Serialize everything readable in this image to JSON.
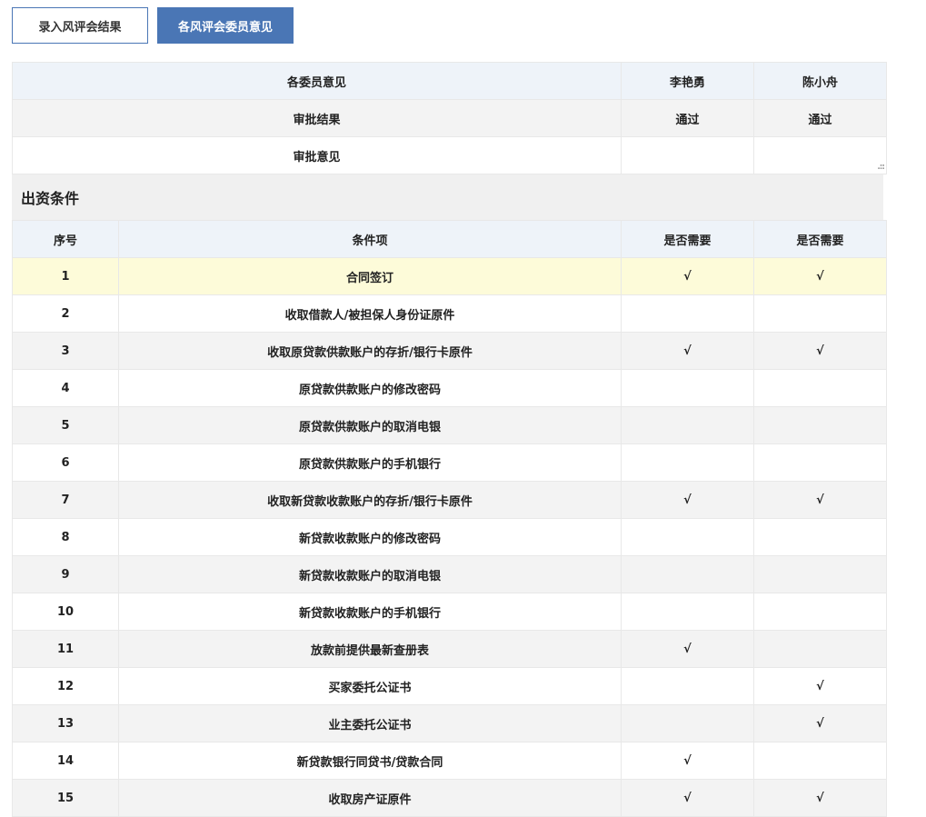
{
  "tabs": {
    "enter_result": "录入风评会结果",
    "member_opinions": "各风评会委员意见"
  },
  "opinions": {
    "header_label": "各委员意见",
    "members": [
      "李艳勇",
      "陈小舟"
    ],
    "result_label": "审批结果",
    "results": [
      "通过",
      "通过"
    ],
    "opinion_label": "审批意见",
    "opinions": [
      "",
      ""
    ]
  },
  "conditions": {
    "title": "出资条件",
    "headers": {
      "index": "序号",
      "item": "条件项",
      "need_1": "是否需要",
      "need_2": "是否需要"
    },
    "rows": [
      {
        "no": "1",
        "item": "合同签订",
        "a": "√",
        "b": "√"
      },
      {
        "no": "2",
        "item": "收取借款人/被担保人身份证原件",
        "a": "",
        "b": ""
      },
      {
        "no": "3",
        "item": "收取原贷款供款账户的存折/银行卡原件",
        "a": "√",
        "b": "√"
      },
      {
        "no": "4",
        "item": "原贷款供款账户的修改密码",
        "a": "",
        "b": ""
      },
      {
        "no": "5",
        "item": "原贷款供款账户的取消电银",
        "a": "",
        "b": ""
      },
      {
        "no": "6",
        "item": "原贷款供款账户的手机银行",
        "a": "",
        "b": ""
      },
      {
        "no": "7",
        "item": "收取新贷款收款账户的存折/银行卡原件",
        "a": "√",
        "b": "√"
      },
      {
        "no": "8",
        "item": "新贷款收款账户的修改密码",
        "a": "",
        "b": ""
      },
      {
        "no": "9",
        "item": "新贷款收款账户的取消电银",
        "a": "",
        "b": ""
      },
      {
        "no": "10",
        "item": "新贷款收款账户的手机银行",
        "a": "",
        "b": ""
      },
      {
        "no": "11",
        "item": "放款前提供最新查册表",
        "a": "√",
        "b": ""
      },
      {
        "no": "12",
        "item": "买家委托公证书",
        "a": "",
        "b": "√"
      },
      {
        "no": "13",
        "item": "业主委托公证书",
        "a": "",
        "b": "√"
      },
      {
        "no": "14",
        "item": "新贷款银行同贷书/贷款合同",
        "a": "√",
        "b": ""
      },
      {
        "no": "15",
        "item": "收取房产证原件",
        "a": "√",
        "b": "√"
      }
    ]
  }
}
